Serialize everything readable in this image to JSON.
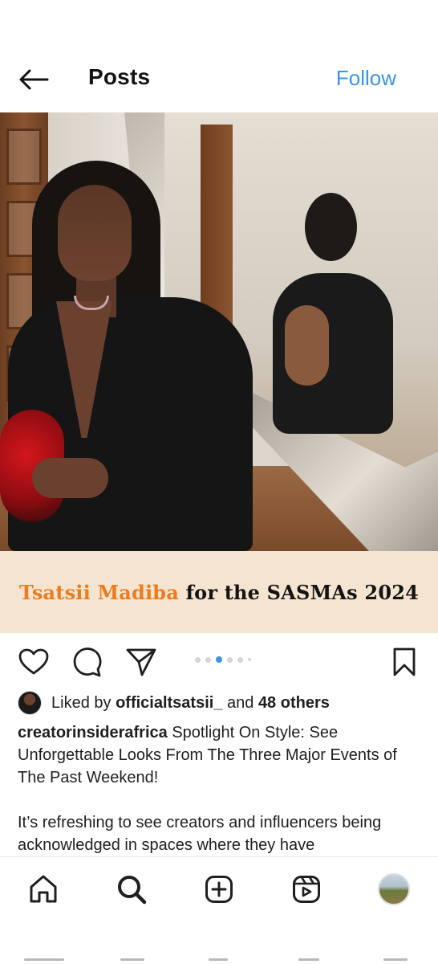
{
  "header": {
    "title": "Posts",
    "follow_label": "Follow"
  },
  "post": {
    "banner": {
      "name": "Tsatsii Madiba",
      "rest": " for the SASMAs 2024"
    },
    "carousel": {
      "count": 6,
      "active_index": 2
    },
    "likes": {
      "prefix": "Liked by ",
      "user": "officialtsatsii_",
      "middle": " and ",
      "others": "48 others"
    },
    "caption": {
      "username": "creatorinsiderafrica",
      "text": " Spotlight On Style: See Unforgettable Looks From The Three Major Events of The Past Weekend!",
      "paragraph2": "It’s refreshing to see creators and influencers being acknowledged in spaces where they have"
    }
  },
  "colors": {
    "accent": "#3c95e3",
    "banner_bg": "#f4e4d0",
    "banner_name": "#ee7b20"
  },
  "icons": {
    "header": [
      "back-arrow-icon"
    ],
    "actions": [
      "heart-icon",
      "comment-icon",
      "share-icon",
      "bookmark-icon"
    ],
    "nav": [
      "home-icon",
      "search-icon",
      "create-icon",
      "reels-icon",
      "profile-avatar"
    ]
  }
}
